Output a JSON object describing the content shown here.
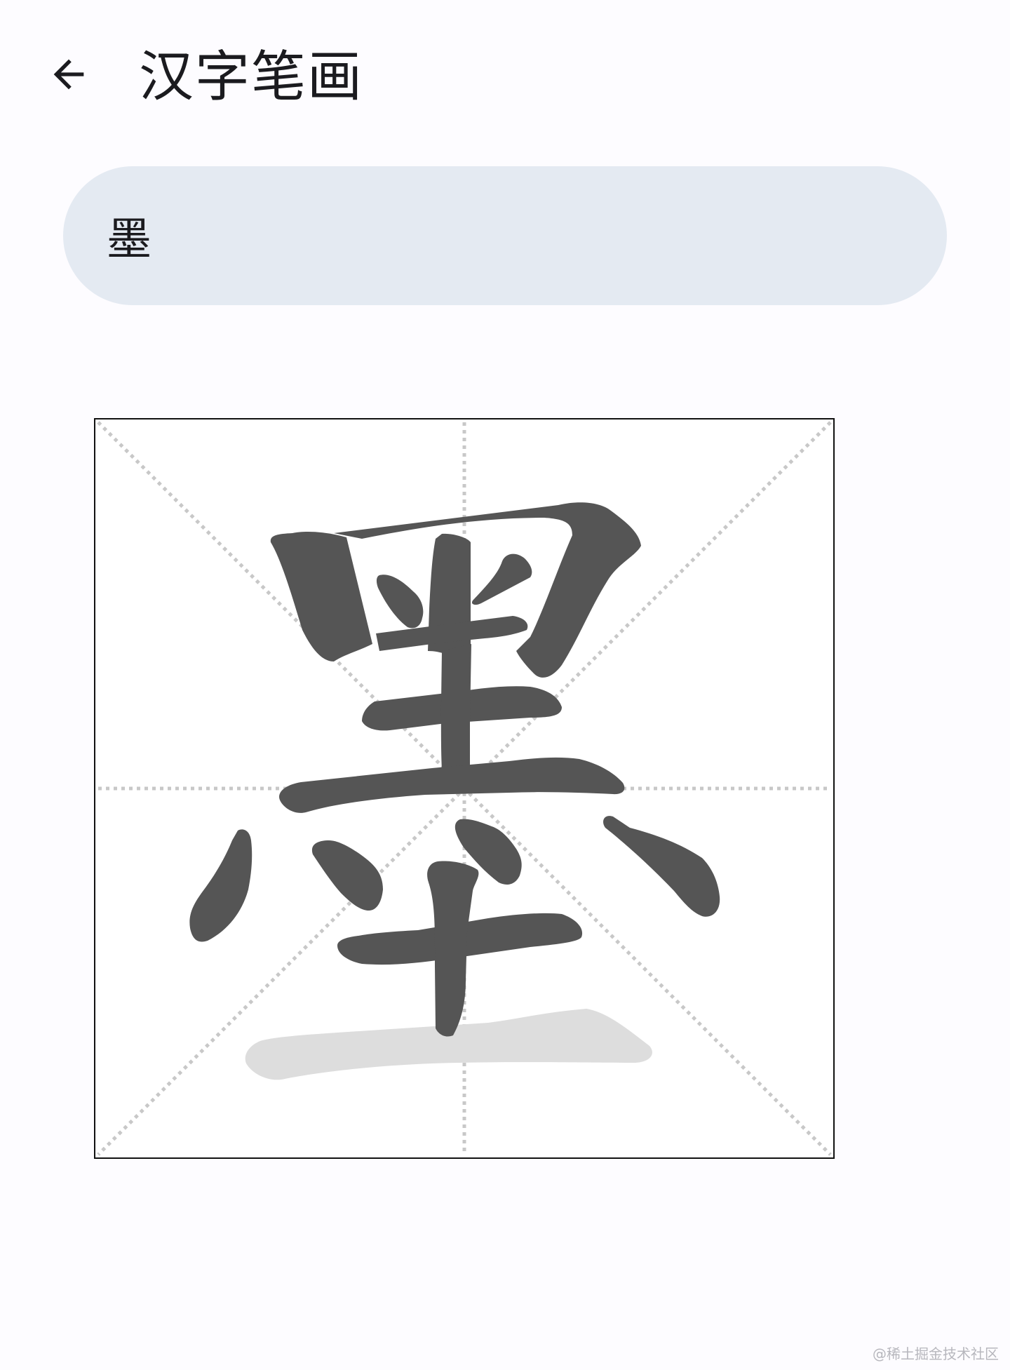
{
  "app_bar": {
    "title": "汉字笔画",
    "back_icon": "arrow-back-icon"
  },
  "search": {
    "value": "墨"
  },
  "board": {
    "character": "墨",
    "guide_color": "#c8c8c8",
    "stroke_color": "#555555",
    "pending_stroke_color": "#dddddd",
    "border_color": "#111111"
  },
  "watermark": "@稀土掘金技术社区"
}
